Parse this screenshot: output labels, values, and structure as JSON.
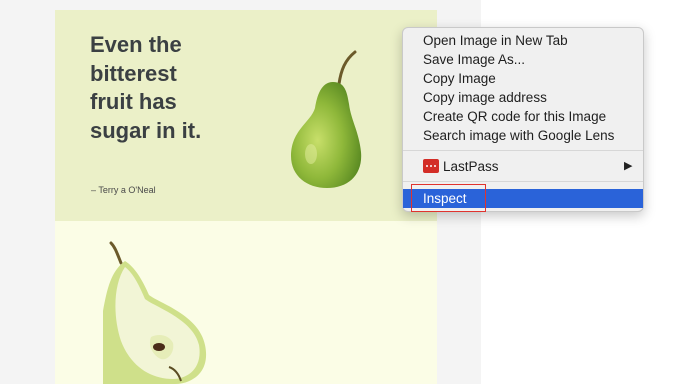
{
  "quote_card": {
    "quote": "Even the\nbitterest\nfruit has\nsugar in it.",
    "author": "– Terry a O'Neal",
    "background": "#ebf0c8"
  },
  "pear_card": {
    "background": "#fbfde6"
  },
  "context_menu": {
    "items": [
      {
        "label": "Open Image in New Tab"
      },
      {
        "label": "Save Image As..."
      },
      {
        "label": "Copy Image"
      },
      {
        "label": "Copy image address"
      },
      {
        "label": "Create QR code for this Image"
      },
      {
        "label": "Search image with Google Lens"
      }
    ],
    "lastpass": {
      "label": "LastPass",
      "icon": "lastpass-icon",
      "arrow_icon": "submenu-arrow-icon",
      "color": "#d32d27"
    },
    "inspect": {
      "label": "Inspect",
      "highlight_color": "#2a63d9",
      "callout_color": "#e0332e"
    }
  }
}
